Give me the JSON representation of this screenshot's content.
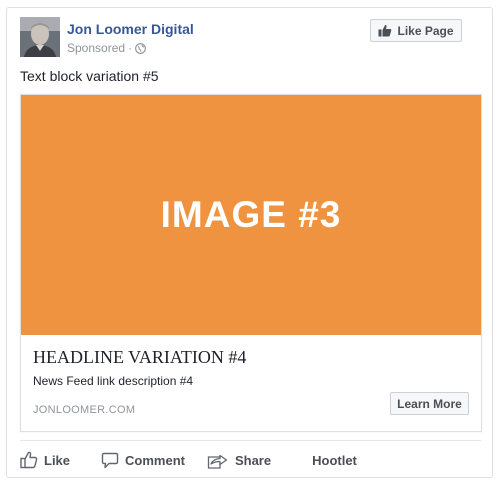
{
  "post": {
    "page_name": "Jon Loomer Digital",
    "sponsored_label": "Sponsored",
    "separator": "·",
    "like_page_label": "Like Page",
    "text": "Text block variation #5"
  },
  "attachment": {
    "image_text": "IMAGE #3",
    "image_color": "#ef9340",
    "headline": "HEADLINE VARIATION #4",
    "description": "News Feed link description #4",
    "domain": "JONLOOMER.COM",
    "cta_label": "Learn More"
  },
  "actions": {
    "like": "Like",
    "comment": "Comment",
    "share": "Share",
    "hootlet": "Hootlet"
  },
  "colors": {
    "link_blue": "#365899",
    "muted_text": "#90949c",
    "button_text": "#4b4f56"
  }
}
